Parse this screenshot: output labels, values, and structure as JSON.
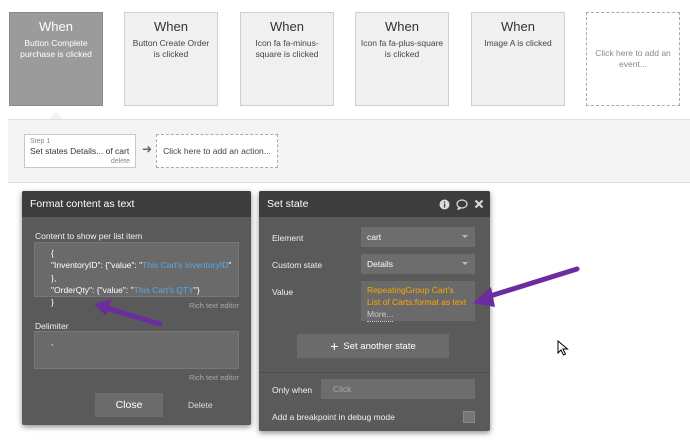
{
  "events": [
    {
      "when": "When",
      "desc": "Button Complete purchase is clicked",
      "active": true
    },
    {
      "when": "When",
      "desc": "Button Create Order is clicked"
    },
    {
      "when": "When",
      "desc": "Icon fa fa-minus-square is clicked"
    },
    {
      "when": "When",
      "desc": "Icon fa fa-plus-square is clicked"
    },
    {
      "when": "When",
      "desc": "Image A is clicked"
    }
  ],
  "add_event_label": "Click here to add an event...",
  "step": {
    "number": "Step 1",
    "title": "Set states Details... of cart",
    "delete": "delete"
  },
  "add_action_label": "Click here to add an action...",
  "format_panel": {
    "title": "Format content as text",
    "content_label": "Content to show per list item",
    "content_lines": {
      "l1": "{",
      "l2_prefix": "\"InventoryID\": {\"value\": \"",
      "l2_dyn": "This Cart's InventoryID",
      "l2_suffix": "\" },",
      "l3_prefix": "\"OrderQty\": {\"value\": \"",
      "l3_dyn": "This Cart's QTY",
      "l3_suffix": "\"}",
      "l4": "}"
    },
    "rich_text_label": "Rich text editor",
    "delimiter_label": "Delimiter",
    "delimiter_value": ",",
    "close_label": "Close",
    "delete_label": "Delete"
  },
  "set_state_panel": {
    "title": "Set state",
    "element_label": "Element",
    "element_value": "cart",
    "custom_state_label": "Custom state",
    "custom_state_value": "Details",
    "value_label": "Value",
    "value_text": "RepeatingGroup Cart's List of Carts:format as text",
    "more_label": "More...",
    "set_another_label": "Set another state",
    "only_when_label": "Only when",
    "only_when_placeholder": "Click",
    "breakpoint_label": "Add a breakpoint in debug mode"
  },
  "colors": {
    "dynamic_blue": "#5aa9e6",
    "dynamic_orange": "#ffa500",
    "annotation_arrow": "#6b2c9e"
  }
}
